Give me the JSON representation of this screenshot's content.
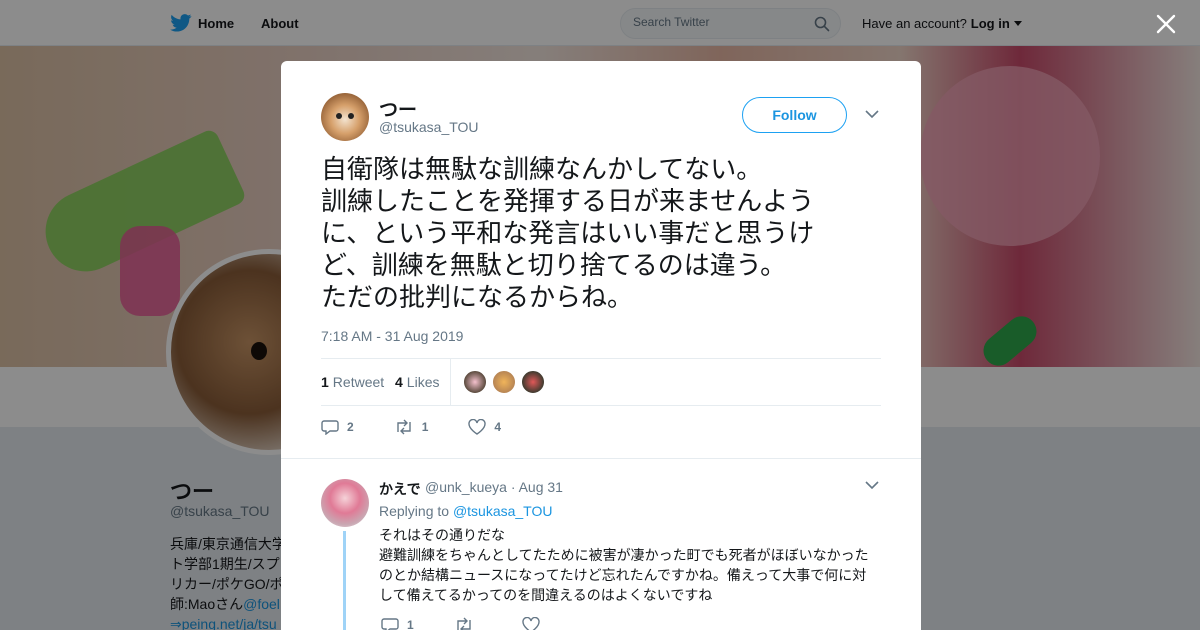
{
  "nav": {
    "home_label": "Home",
    "about_label": "About",
    "search_placeholder": "Search Twitter",
    "have_account": "Have an account?",
    "login_label": "Log in"
  },
  "profile": {
    "name": "つー",
    "handle": "@tsukasa_TOU",
    "bio_text": "兵庫/東京通信大学\nト学部1期生/スプ\nリカー/ポケGO/ポ\n師:Maoさん",
    "bio_mention": "@foel",
    "bio_link": "⇒peing.net/ja/tsu"
  },
  "tweet": {
    "author_name": "つー",
    "author_handle": "@tsukasa_TOU",
    "follow_label": "Follow",
    "text": "自衛隊は無駄な訓練なんかしてない。\n訓練したことを発揮する日が来ませんよう\nに、という平和な発言はいい事だと思うけ\nど、訓練を無駄と切り捨てるのは違う。\nただの批判になるからね。",
    "timestamp": "7:18 AM - 31 Aug 2019",
    "retweet_count": "1",
    "retweet_label": "Retweet",
    "like_count": "4",
    "like_label": "Likes",
    "actions": {
      "reply_count": "2",
      "retweet_count": "1",
      "like_count": "4"
    }
  },
  "reply": {
    "author_name": "かえで",
    "author_handle": "@unk_kueya · Aug 31",
    "replying_prefix": "Replying to",
    "replying_mention": "@tsukasa_TOU",
    "text": "それはその通りだな\n避難訓練をちゃんとしてたために被害が凄かった町でも死者がほぼいなかった\nのとか結構ニュースになってたけど忘れたんですかね。備えって大事で何に対\nして備えてるかってのを間違えるのはよくないですね",
    "actions": {
      "reply_count": "1",
      "retweet_count": "",
      "like_count": ""
    }
  },
  "colors": {
    "brand_blue": "#1da1f2",
    "link_blue": "#1b95e0",
    "muted_text": "#657786"
  }
}
